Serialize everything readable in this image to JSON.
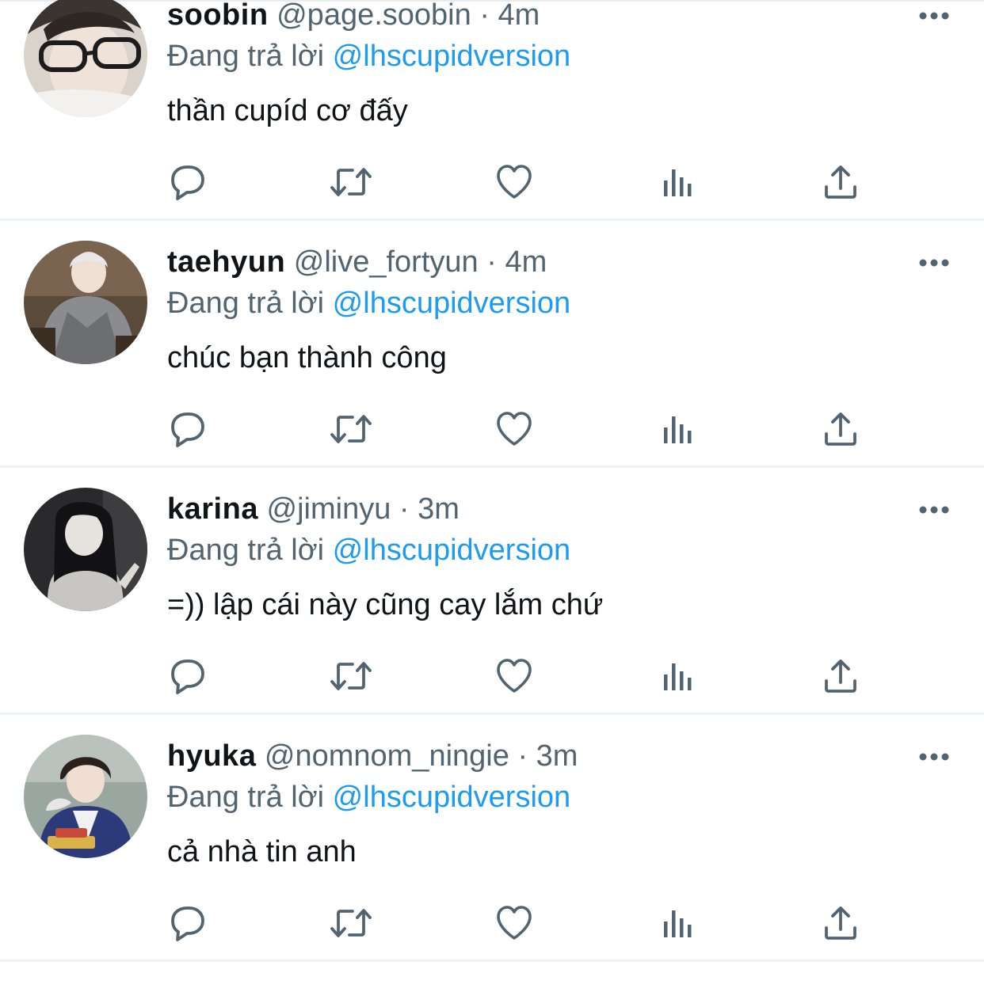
{
  "colors": {
    "text": "#0f1419",
    "secondary": "#536471",
    "mention": "#1d9bf0",
    "divider": "#eff3f4"
  },
  "reply_prefix": "Đang trả lời",
  "tweets": [
    {
      "name": "soobin",
      "handle": "@page.soobin",
      "dot": "·",
      "time": "4m",
      "reply_to": "@lhscupidversion",
      "text": "thần cupíd cơ đấy"
    },
    {
      "name": "taehyun",
      "handle": "@live_fortyun",
      "dot": "·",
      "time": "4m",
      "reply_to": "@lhscupidversion",
      "text": "chúc bạn thành công"
    },
    {
      "name": "karina",
      "handle": "@jiminyu",
      "dot": "·",
      "time": "3m",
      "reply_to": "@lhscupidversion",
      "text": "=)) lập cái này cũng cay lắm chứ"
    },
    {
      "name": "hyuka",
      "handle": "@nomnom_ningie",
      "dot": "·",
      "time": "3m",
      "reply_to": "@lhscupidversion",
      "text": "cả nhà tin anh"
    }
  ],
  "icons": {
    "reply": "reply-icon",
    "retweet": "retweet-icon",
    "like": "like-icon",
    "views": "views-icon",
    "share": "share-icon",
    "more": "more-icon"
  }
}
